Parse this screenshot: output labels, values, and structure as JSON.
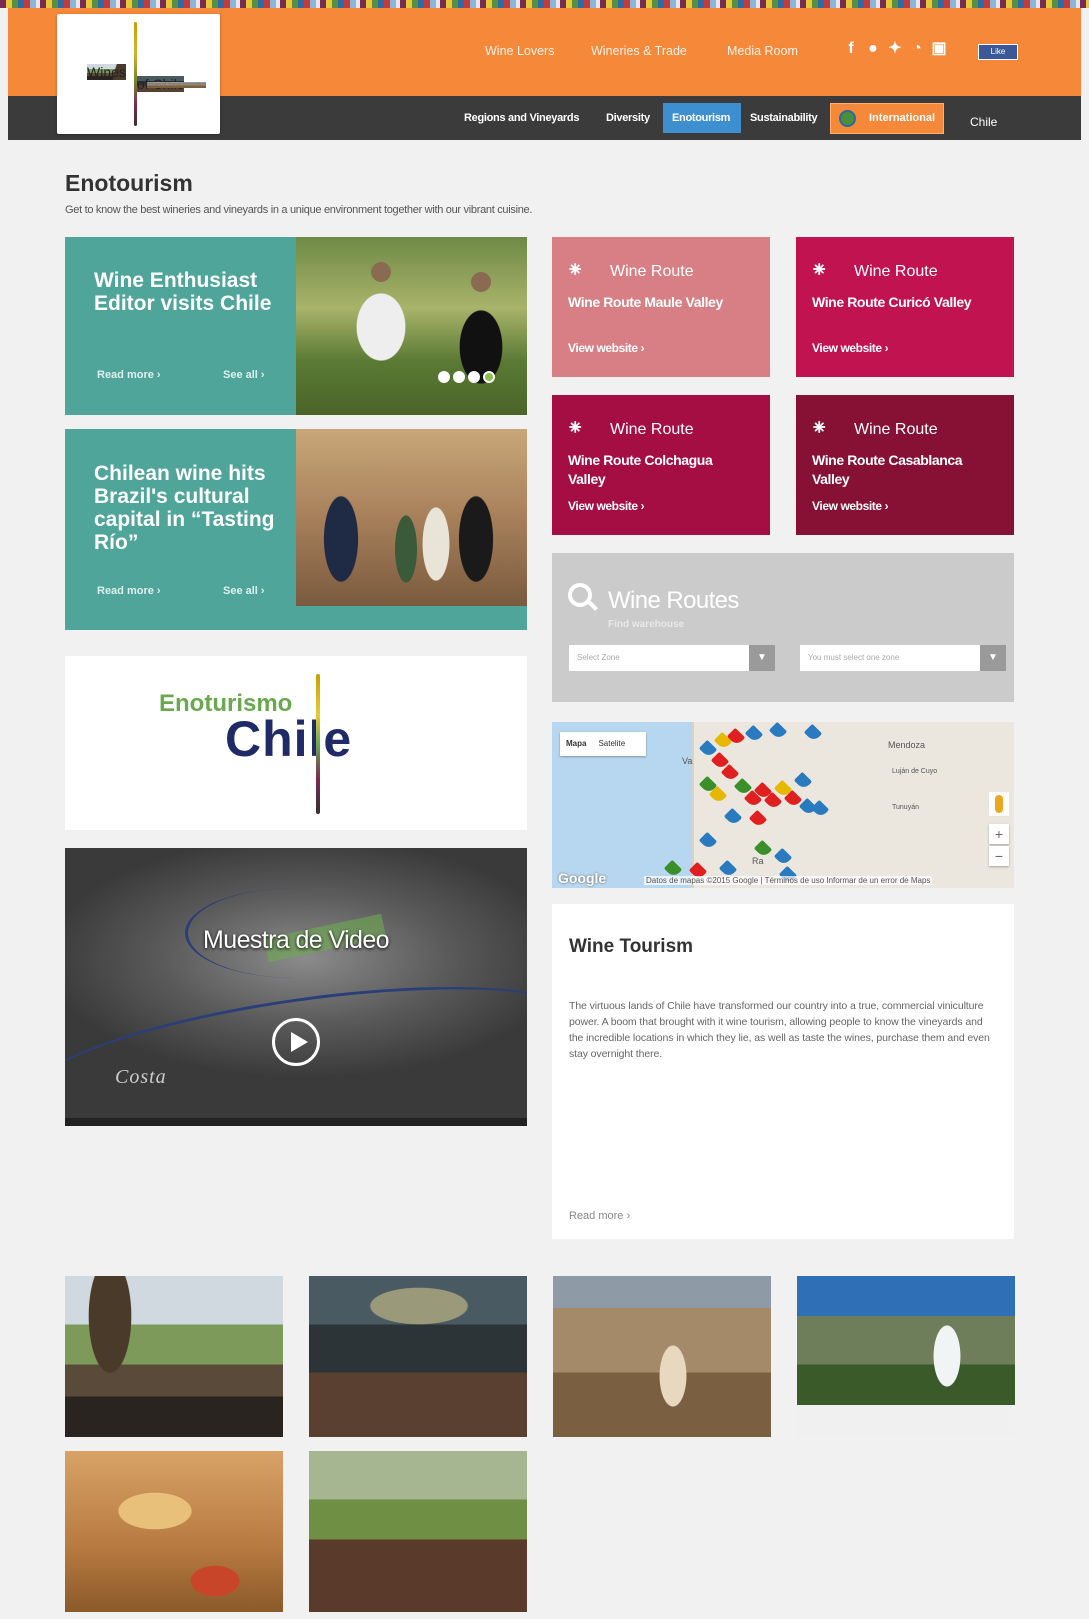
{
  "header": {
    "logo": {
      "line1": "Wines",
      "line2": "of Chile",
      "tagline": "Wines of Social Innovation"
    },
    "top_nav": [
      "Wine Lovers",
      "Wineries & Trade",
      "Media Room"
    ],
    "social_icons": [
      "facebook-icon",
      "flickr-icon",
      "twitter-icon",
      "weibo-icon",
      "youtube-icon"
    ],
    "fb_like": "Like",
    "sub_nav": [
      "Regions and Vineyards",
      "Diversity",
      "Enotourism",
      "Sustainability"
    ],
    "active_tab": "Enotourism",
    "international": "International",
    "chile_mark": "Chile"
  },
  "page": {
    "title": "Enotourism",
    "subtitle": "Get to know the best wineries and vineyards in a unique environment together with our vibrant cuisine."
  },
  "news": [
    {
      "title": "Wine Enthusiast Editor visits Chile",
      "read_more": "Read more",
      "see_all": "See all"
    },
    {
      "title": "Chilean wine hits Brazil's cultural capital in “Tasting Río”",
      "read_more": "Read more",
      "see_all": "See all"
    }
  ],
  "carousel": {
    "count": 4,
    "active": 4
  },
  "routes": [
    {
      "kind": "Wine Route",
      "name": "Wine Route Maule Valley",
      "link": "View website",
      "color": "#d77f85"
    },
    {
      "kind": "Wine Route",
      "name": "Wine Route Curicó Valley",
      "link": "View website",
      "color": "#c0134f"
    },
    {
      "kind": "Wine Route",
      "name": "Wine Route Colchagua Valley",
      "link": "View website",
      "color": "#a40e42"
    },
    {
      "kind": "Wine Route",
      "name": "Wine Route Casablanca Valley",
      "link": "View website",
      "color": "#861135"
    }
  ],
  "routes_search": {
    "title": "Wine Routes",
    "hint": "Find warehouse",
    "zone_placeholder": "Select Zone",
    "sub_placeholder": "You must select one zone"
  },
  "map": {
    "tab_map": "Mapa",
    "tab_satellite": "Satelite",
    "cities": [
      "Mendoza",
      "Luján de Cuyo",
      "Tunuyán",
      "Va",
      "Ra"
    ],
    "google": "Google",
    "credits": "Datos de mapas ©2015 Google | Términos de uso   Informar de un error de Maps"
  },
  "tourism": {
    "title": "Wine Tourism",
    "text": "The virtuous lands of Chile have transformed our country into a true, commercial viniculture power. A boom that brought with it wine tourism, allowing people to know the vineyards and the incredible locations in which they lie, as well as taste the wines, purchase them and even stay overnight there.",
    "read_more": "Read more"
  },
  "enologo": {
    "line1": "Enoturismo",
    "line2": "Chile"
  },
  "video": {
    "title": "Muestra de Video",
    "caption": "Costa"
  },
  "gallery": [
    "winery-lunch-table-photo",
    "conference-room-photo",
    "horseback-riding-photo",
    "outdoor-wine-glass-photo",
    "bread-and-salsa-photo",
    "vineyard-table-photo"
  ]
}
